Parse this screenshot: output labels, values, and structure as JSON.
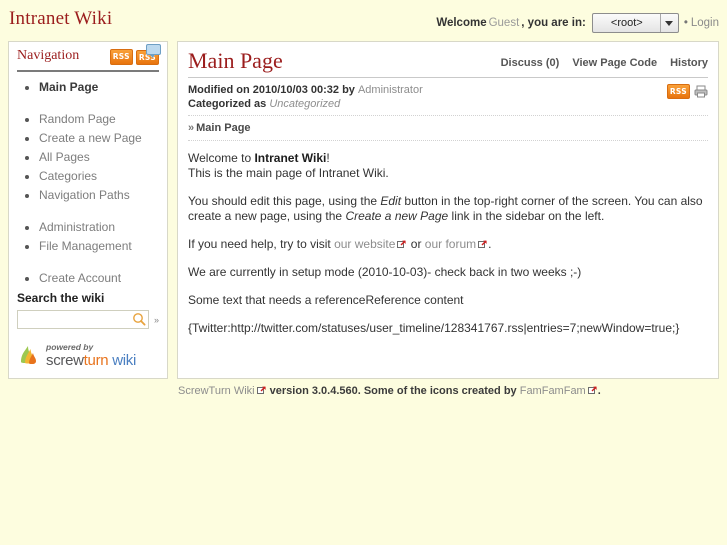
{
  "header": {
    "site_title": "Intranet Wiki",
    "welcome_label": "Welcome",
    "guest_name": "Guest",
    "you_are_in": ", you are in:",
    "namespace_value": "<root>",
    "namespace_options": [
      "<root>"
    ],
    "separator": "•",
    "login_label": "Login"
  },
  "sidebar": {
    "title": "Navigation",
    "rss_label": "RSS",
    "rss_discuss_label": "RSS",
    "items": [
      {
        "label": "Main Page",
        "current": true
      },
      {
        "label": "Random Page",
        "current": false
      },
      {
        "label": "Create a new Page",
        "current": false
      },
      {
        "label": "All Pages",
        "current": false
      },
      {
        "label": "Categories",
        "current": false
      },
      {
        "label": "Navigation Paths",
        "current": false
      },
      {
        "label": "Administration",
        "current": false
      },
      {
        "label": "File Management",
        "current": false
      },
      {
        "label": "Create Account",
        "current": false
      }
    ],
    "search": {
      "title": "Search the wiki",
      "value": "",
      "placeholder": "",
      "more_label": "»"
    },
    "logo": {
      "powered_by": "powered by",
      "word_screw": "screw",
      "word_turn": "turn",
      "word_wiki": " wiki"
    }
  },
  "content": {
    "page_title": "Main Page",
    "actions": [
      {
        "label": "Discuss (0)"
      },
      {
        "label": "View Page Code"
      },
      {
        "label": "History"
      }
    ],
    "meta": {
      "modified_prefix": "Modified on 2010/10/03 00:32 by",
      "modified_user": "Administrator",
      "categorized_prefix": "Categorized as",
      "categorized_value": "Uncategorized",
      "rss_label": "RSS"
    },
    "breadcrumb": {
      "arrow": "»",
      "label": "Main Page"
    },
    "paragraphs": {
      "p1_a": "Welcome to ",
      "p1_b": "Intranet Wiki",
      "p1_c": "!",
      "p1_line2": "This is the main page of Intranet Wiki.",
      "p2_a": "You should edit this page, using the ",
      "p2_b": "Edit",
      "p2_c": " button in the top-right corner of the screen. You can also create a new page, using the ",
      "p2_d": "Create a new Page",
      "p2_e": " link in the sidebar on the left.",
      "p3_a": "If you need help, try to visit ",
      "p3_link1": "our website",
      "p3_b": " or ",
      "p3_link2": "our forum",
      "p3_c": ".",
      "p4": "We are currently in setup mode (2010-10-03)- check back in two weeks ;-)",
      "p5": "Some text that needs a referenceReference content",
      "p6": "{Twitter:http://twitter.com/statuses/user_timeline/128341767.rss|entries=7;newWindow=true;}"
    }
  },
  "footer": {
    "product_link": "ScrewTurn Wiki",
    "version_text": " version 3.0.4.560. Some of the icons created by ",
    "icons_link": "FamFamFam",
    "period": "."
  },
  "colors": {
    "page_bg": "#fdfddf",
    "panel_bg": "#ffffff",
    "panel_border": "#d8d8c8",
    "heading_red": "#9b1d1d",
    "muted_gray": "#8d8d8d",
    "rss_orange": "#e8730c",
    "logo_turn_orange": "#e8741e",
    "logo_wiki_blue": "#4a7fc1"
  }
}
